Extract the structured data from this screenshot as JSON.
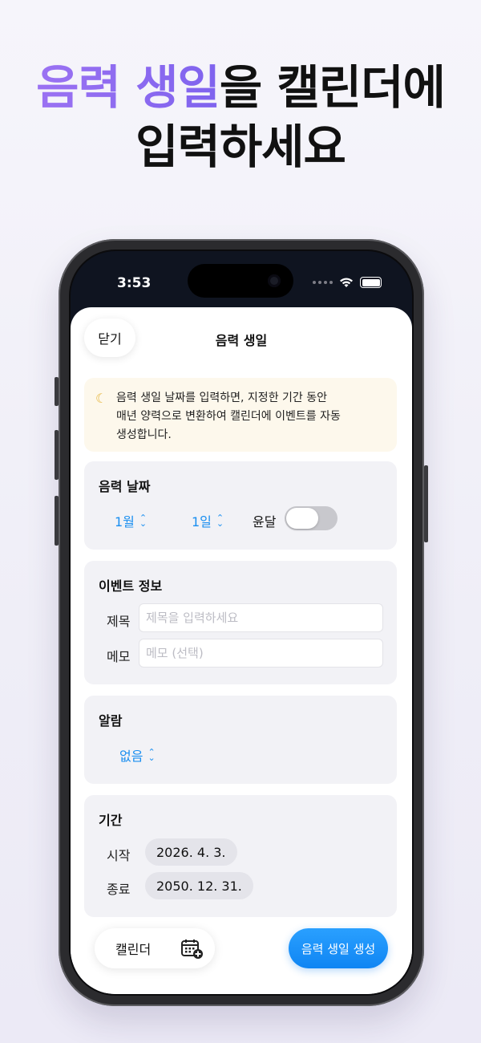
{
  "headline": {
    "accent": "음력 생일",
    "rest_line1": "을 캘린더에",
    "line2": "입력하세요"
  },
  "status_bar": {
    "time": "3:53"
  },
  "sheet": {
    "close_label": "닫기",
    "title": "음력 생일",
    "info": "음력 생일 날짜를 입력하면, 지정한 기간 동안 매년 양력으로 변환하여 캘린더에 이벤트를 자동 생성합니다.",
    "info_line1": "음력 생일 날짜를 입력하면, 지정한 기간 동안",
    "info_line2": "매년 양력으로 변환하여 캘린더에 이벤트를 자동",
    "info_line3": "생성합니다."
  },
  "lunar_date": {
    "title": "음력 날짜",
    "month": "1월",
    "day": "1일",
    "leap_label": "윤달",
    "leap_on": false
  },
  "event_info": {
    "title": "이벤트 정보",
    "title_label": "제목",
    "title_placeholder": "제목을 입력하세요",
    "memo_label": "메모",
    "memo_placeholder": "메모 (선택)"
  },
  "alarm": {
    "title": "알람",
    "value": "없음"
  },
  "period": {
    "title": "기간",
    "start_label": "시작",
    "start_value": "2026. 4. 3.",
    "end_label": "종료",
    "end_value": "2050. 12. 31."
  },
  "actions": {
    "calendar_label": "캘린더",
    "create_label": "음력 생일 생성"
  },
  "colors": {
    "accent_purple": "#8b6cf0",
    "blue": "#1a8ff0",
    "info_bg": "#fdf8ec",
    "card_bg": "#f2f2f6"
  }
}
